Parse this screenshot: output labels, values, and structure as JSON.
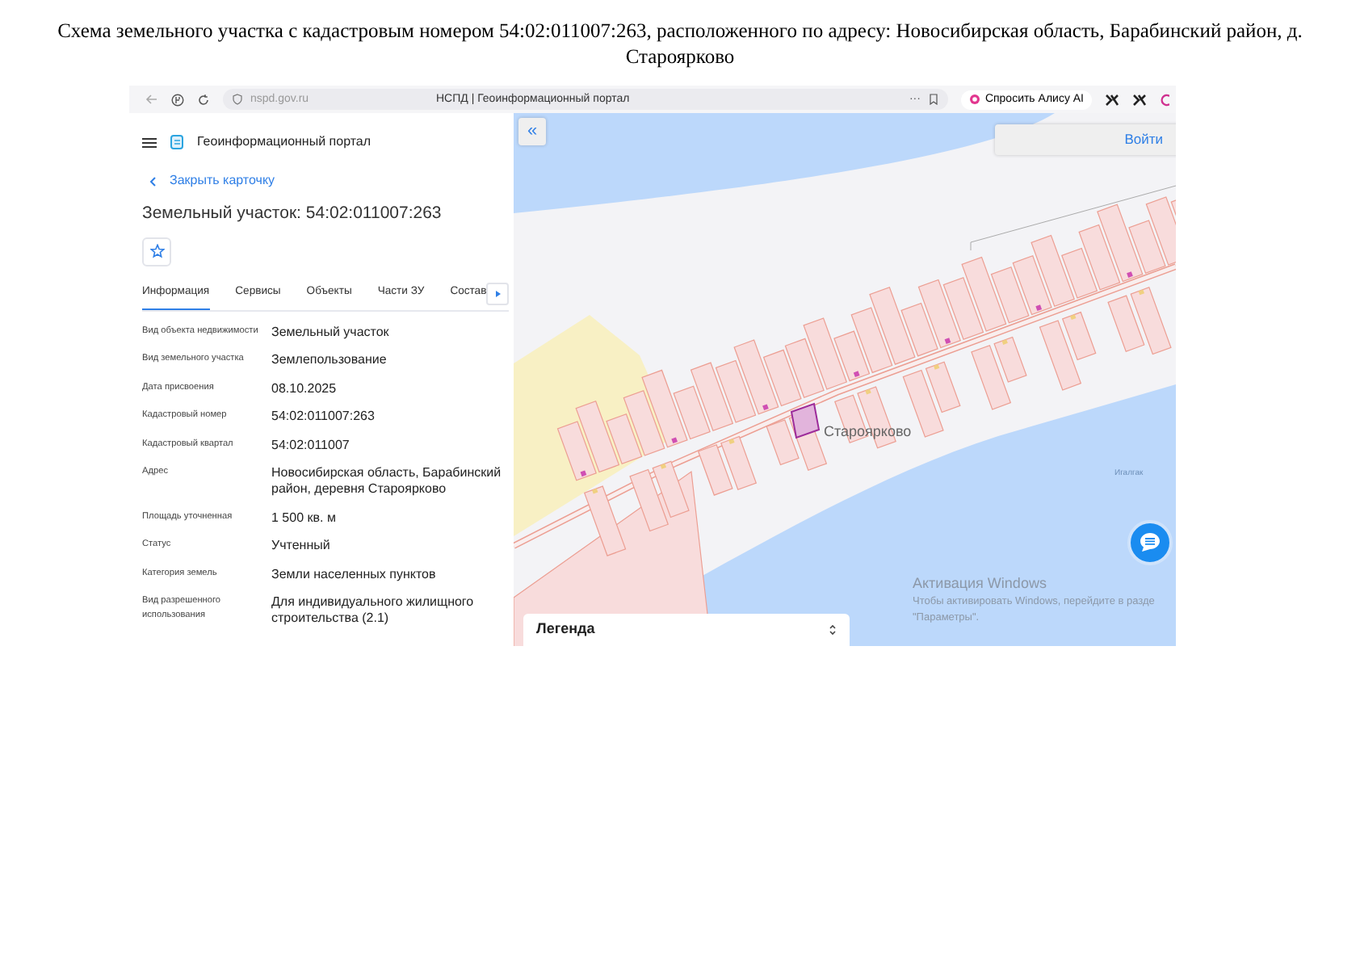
{
  "document_title": "Схема земельного участка с кадастровым номером 54:02:011007:263, расположенного по адресу: Новосибирская область, Барабинский район, д. Староярково",
  "browser": {
    "url": "nspd.gov.ru",
    "tab_title": "НСПД | Геоинформационный портал",
    "more": "···",
    "assistant_button": "Спросить Алису AI"
  },
  "portal": {
    "name": "Геоинформационный портал"
  },
  "card": {
    "back_link": "Закрыть карточку",
    "title": "Земельный участок: 54:02:011007:263",
    "tabs": [
      {
        "label": "Информация",
        "selected": true
      },
      {
        "label": "Сервисы",
        "selected": false
      },
      {
        "label": "Объекты",
        "selected": false
      },
      {
        "label": "Части ЗУ",
        "selected": false
      },
      {
        "label": "Состав",
        "selected": false
      }
    ],
    "properties": [
      {
        "label": "Вид объекта недвижимости",
        "value": "Земельный участок"
      },
      {
        "label": "Вид земельного участка",
        "value": "Землепользование"
      },
      {
        "label": "Дата присвоения",
        "value": "08.10.2025"
      },
      {
        "label": "Кадастровый номер",
        "value": "54:02:011007:263"
      },
      {
        "label": "Кадастровый квартал",
        "value": "54:02:011007"
      },
      {
        "label": "Адрес",
        "value": "Новосибирская область, Барабинский район, деревня Староярково"
      },
      {
        "label": "Площадь уточненная",
        "value": "1 500 кв. м"
      },
      {
        "label": "Статус",
        "value": "Учтенный"
      },
      {
        "label": "Категория земель",
        "value": "Земли населенных пунктов"
      },
      {
        "label": "Вид разрешенного использования",
        "value": "Для индивидуального жилищного строительства (2.1)"
      }
    ]
  },
  "map": {
    "collapse": "«",
    "login": "Войти",
    "place_labels": [
      "Староярково",
      "Игалгак"
    ],
    "legend": "Легенда",
    "notice": {
      "title": "Активация Windows",
      "line_1": "Чтобы активировать Windows, перейдите в разде",
      "line_2": "\"Параметры\"."
    }
  }
}
